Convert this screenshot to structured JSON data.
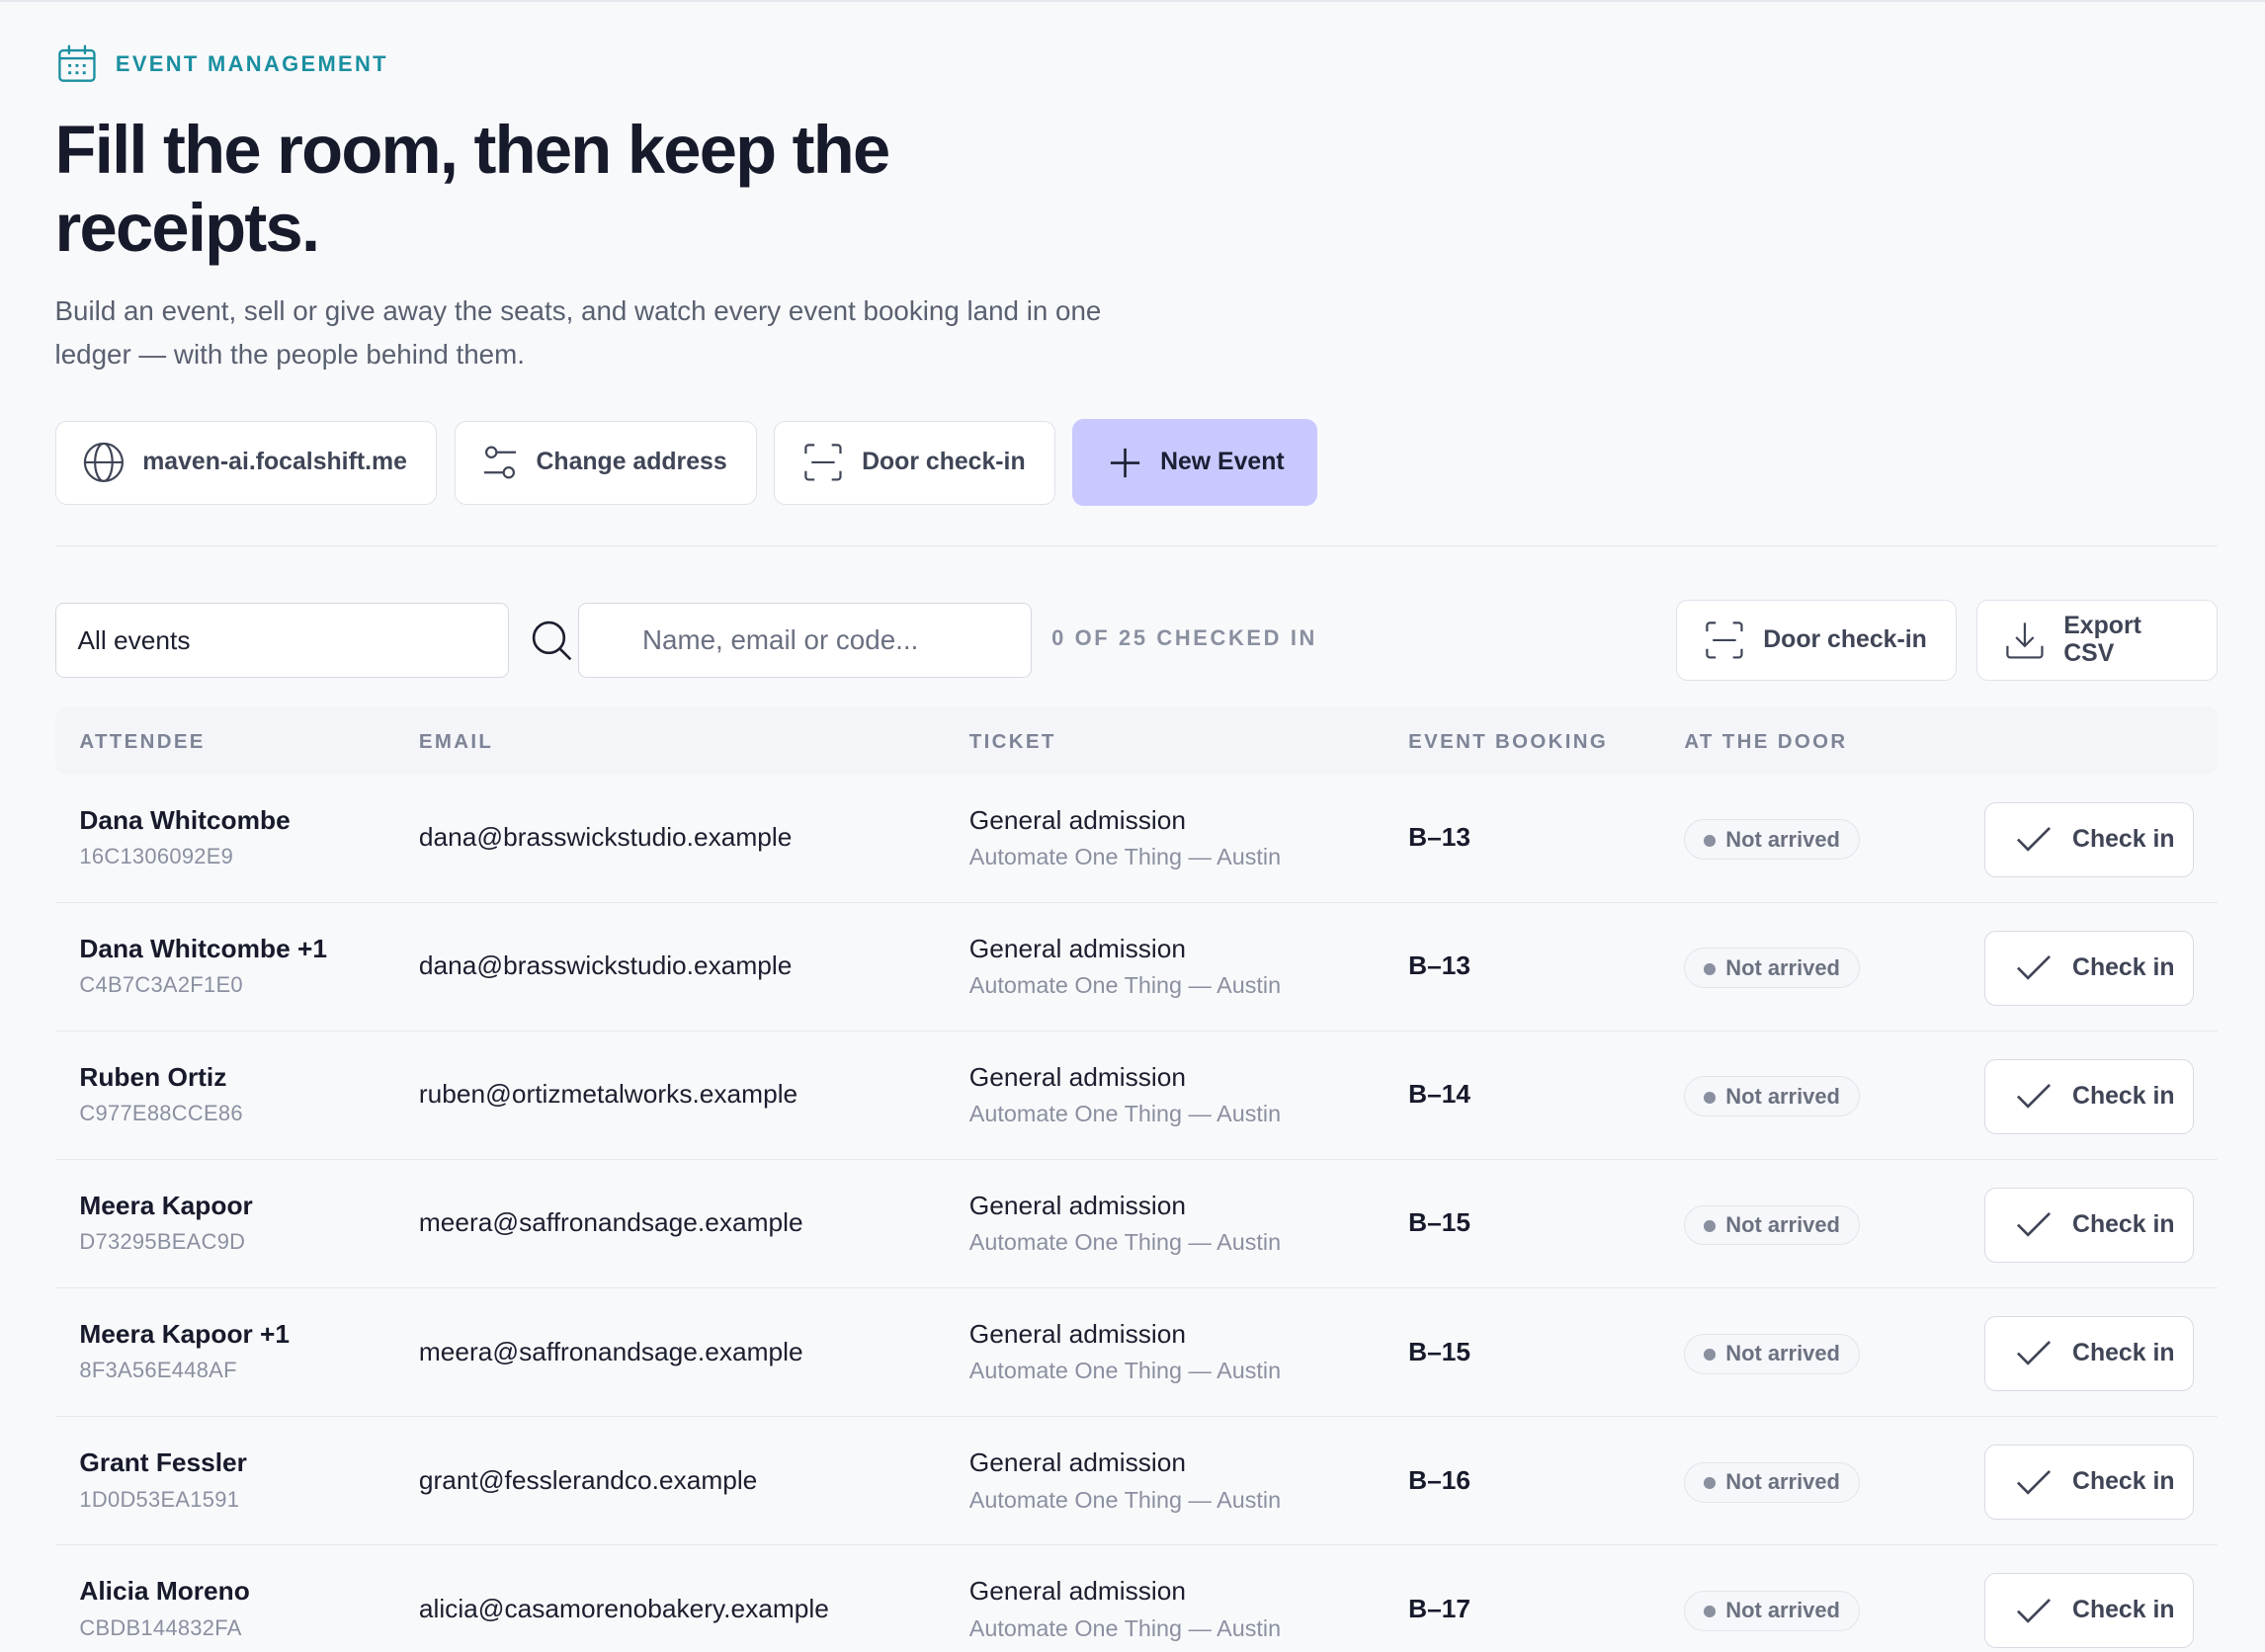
{
  "header": {
    "eyebrow": "EVENT MANAGEMENT",
    "eyebrow_icon": "calendar-icon",
    "title": "Fill the room, then keep the receipts.",
    "lede": "Build an event, sell or give away the seats, and watch every event booking land in one ledger — with the people behind them."
  },
  "actions": {
    "domain_label": "maven-ai.focalshift.me",
    "change_address_label": "Change address",
    "door_checkin_label": "Door check-in",
    "new_event_label": "New Event"
  },
  "toolbar": {
    "event_filter": "All events",
    "search_placeholder": "Name, email or code...",
    "checked_in_status": "0 OF 25 CHECKED IN",
    "door_checkin_label": "Door check-in",
    "export_label": "Export CSV"
  },
  "table": {
    "columns": [
      "ATTENDEE",
      "EMAIL",
      "TICKET",
      "EVENT BOOKING",
      "AT THE DOOR"
    ],
    "rows": [
      {
        "name": "Dana Whitcombe",
        "code": "16C1306092E9",
        "email": "dana@brasswickstudio.example",
        "ticket": "General admission",
        "event": "Automate One Thing — Austin",
        "booking": "B–13",
        "status": "Not arrived",
        "action": "Check in"
      },
      {
        "name": "Dana Whitcombe +1",
        "code": "C4B7C3A2F1E0",
        "email": "dana@brasswickstudio.example",
        "ticket": "General admission",
        "event": "Automate One Thing — Austin",
        "booking": "B–13",
        "status": "Not arrived",
        "action": "Check in"
      },
      {
        "name": "Ruben Ortiz",
        "code": "C977E88CCE86",
        "email": "ruben@ortizmetalworks.example",
        "ticket": "General admission",
        "event": "Automate One Thing — Austin",
        "booking": "B–14",
        "status": "Not arrived",
        "action": "Check in"
      },
      {
        "name": "Meera Kapoor",
        "code": "D73295BEAC9D",
        "email": "meera@saffronandsage.example",
        "ticket": "General admission",
        "event": "Automate One Thing — Austin",
        "booking": "B–15",
        "status": "Not arrived",
        "action": "Check in"
      },
      {
        "name": "Meera Kapoor +1",
        "code": "8F3A56E448AF",
        "email": "meera@saffronandsage.example",
        "ticket": "General admission",
        "event": "Automate One Thing — Austin",
        "booking": "B–15",
        "status": "Not arrived",
        "action": "Check in"
      },
      {
        "name": "Grant Fessler",
        "code": "1D0D53EA1591",
        "email": "grant@fesslerandco.example",
        "ticket": "General admission",
        "event": "Automate One Thing — Austin",
        "booking": "B–16",
        "status": "Not arrived",
        "action": "Check in"
      },
      {
        "name": "Alicia Moreno",
        "code": "CBDB144832FA",
        "email": "alicia@casamorenobakery.example",
        "ticket": "General admission",
        "event": "Automate One Thing — Austin",
        "booking": "B–17",
        "status": "Not arrived",
        "action": "Check in"
      }
    ]
  },
  "colors": {
    "accent": "#1a8fa0",
    "primary_button": "#c9c9ff",
    "heading": "#161a2b",
    "muted": "#8a90a0"
  }
}
